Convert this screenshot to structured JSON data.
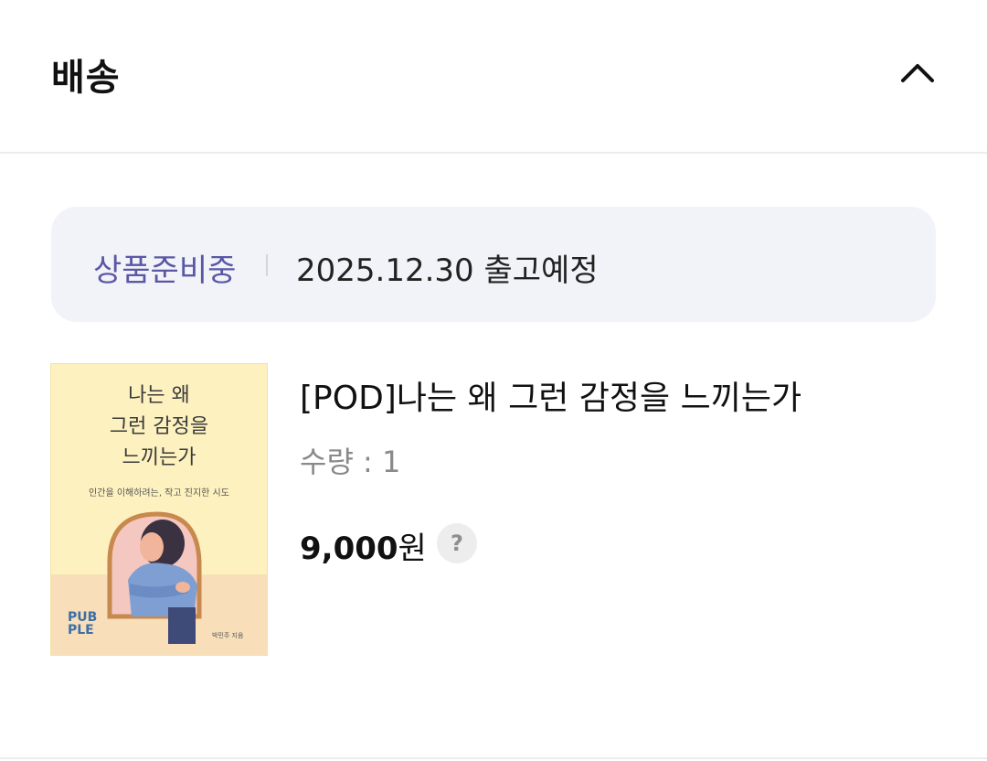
{
  "header": {
    "title": "배송",
    "collapse_icon": "chevron-up-icon"
  },
  "status": {
    "label": "상품준비중",
    "date_text": "2025.12.30 출고예정",
    "label_color": "#5a58a5"
  },
  "product": {
    "title": "[POD]나는 왜 그런 감정을 느끼는가",
    "quantity_text": "수량 : 1",
    "price": "9,000",
    "price_unit": "원",
    "help_icon": "question-icon",
    "help_label": "?",
    "cover": {
      "title_lines": [
        "나는 왜",
        "그런 감정을",
        "느끼는가"
      ],
      "subtitle": "인간을 이해하려는, 작고 진지한 시도",
      "publisher_logo_lines": [
        "PUB",
        "PLE"
      ],
      "author": "박민주 지음"
    }
  }
}
